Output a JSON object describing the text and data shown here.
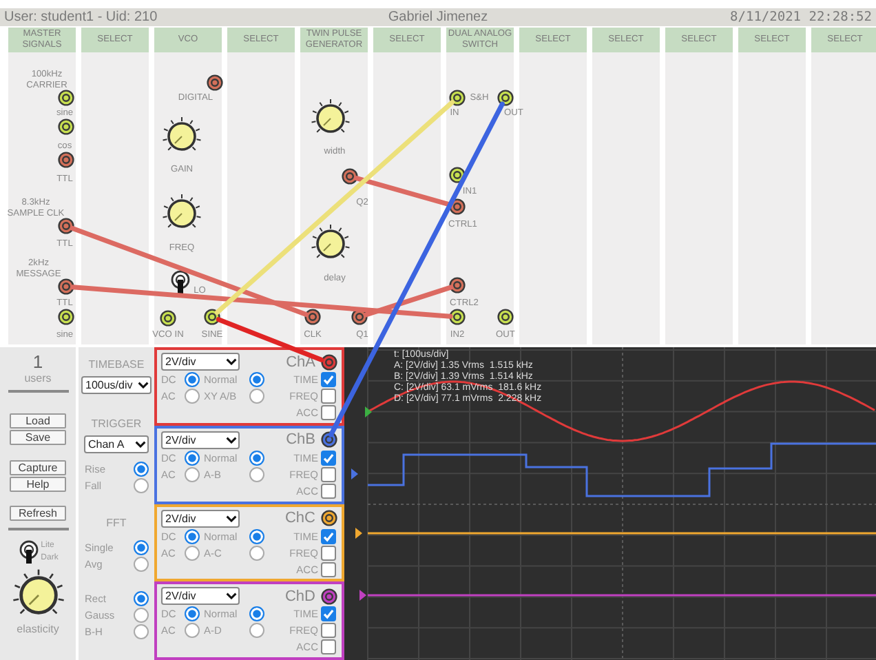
{
  "header": {
    "user": "User: student1 - Uid: 210",
    "name": "Gabriel Jimenez",
    "datetime": "8/11/2021 22:28:52"
  },
  "modules": [
    {
      "title": "MASTER SIGNALS",
      "kind": "master",
      "items": [
        {
          "kind": "text",
          "label": "100kHz\nCARRIER"
        },
        {
          "kind": "jack",
          "color": "#c8e050"
        },
        {
          "kind": "text",
          "label": "sine"
        },
        {
          "kind": "jack",
          "color": "#c8e050"
        },
        {
          "kind": "text",
          "label": "cos"
        },
        {
          "kind": "jack",
          "color": "#d4705a"
        },
        {
          "kind": "text",
          "label": "TTL"
        },
        {
          "kind": "text",
          "label": "8.3kHz\nSAMPLE CLK"
        },
        {
          "kind": "jack",
          "color": "#d4705a"
        },
        {
          "kind": "text",
          "label": "TTL"
        },
        {
          "kind": "text",
          "label": "2kHz\nMESSAGE"
        },
        {
          "kind": "jack",
          "color": "#d4705a"
        },
        {
          "kind": "text",
          "label": "TTL"
        },
        {
          "kind": "jack",
          "color": "#c8e050"
        },
        {
          "kind": "text",
          "label": "sine"
        }
      ]
    },
    {
      "title": "SELECT"
    },
    {
      "title": "VCO",
      "kind": "vco",
      "items": [
        {
          "kind": "jack",
          "color": "#d4705a"
        },
        {
          "kind": "text",
          "label": "DIGITAL"
        },
        {
          "kind": "knob"
        },
        {
          "kind": "text",
          "label": "GAIN"
        },
        {
          "kind": "knob"
        },
        {
          "kind": "text",
          "label": "FREQ"
        },
        {
          "kind": "toggle",
          "on": false
        },
        {
          "kind": "text",
          "label": "LO"
        },
        {
          "kind": "jack",
          "color": "#c8e050"
        },
        {
          "kind": "text",
          "label": "VCO IN"
        },
        {
          "kind": "jack",
          "color": "#c8e050"
        },
        {
          "kind": "text",
          "label": "SINE"
        }
      ]
    },
    {
      "title": "SELECT"
    },
    {
      "title": "TWIN PULSE GENERATOR",
      "kind": "twin",
      "items": [
        {
          "kind": "knob"
        },
        {
          "kind": "text",
          "label": "width"
        },
        {
          "kind": "jack",
          "color": "#d4705a"
        },
        {
          "kind": "text",
          "label": "Q2"
        },
        {
          "kind": "knob"
        },
        {
          "kind": "text",
          "label": "delay"
        },
        {
          "kind": "jack",
          "color": "#d4705a"
        },
        {
          "kind": "text",
          "label": "CLK"
        },
        {
          "kind": "jack",
          "color": "#d4705a"
        },
        {
          "kind": "text",
          "label": "Q1"
        }
      ]
    },
    {
      "title": "SELECT"
    },
    {
      "title": "DUAL ANALOG SWITCH",
      "kind": "switch",
      "items": [
        {
          "kind": "jack",
          "color": "#c8e050"
        },
        {
          "kind": "text",
          "label": "S&H"
        },
        {
          "kind": "jack",
          "color": "#c8e050"
        },
        {
          "kind": "text",
          "label": "IN"
        },
        {
          "kind": "text",
          "label": "OUT"
        },
        {
          "kind": "jack",
          "color": "#c8e050"
        },
        {
          "kind": "text",
          "label": "IN1"
        },
        {
          "kind": "jack",
          "color": "#d4705a"
        },
        {
          "kind": "text",
          "label": "CTRL1"
        },
        {
          "kind": "jack",
          "color": "#d4705a"
        },
        {
          "kind": "text",
          "label": "CTRL2"
        },
        {
          "kind": "jack",
          "color": "#c8e050"
        },
        {
          "kind": "text",
          "label": "IN2"
        },
        {
          "kind": "jack",
          "color": "#c8e050"
        },
        {
          "kind": "text",
          "label": "OUT"
        }
      ]
    },
    {
      "title": "SELECT"
    },
    {
      "title": "SELECT"
    },
    {
      "title": "SELECT"
    },
    {
      "title": "SELECT"
    },
    {
      "title": "SELECT"
    }
  ],
  "sidebar": {
    "users_count": "1",
    "users_label": "users",
    "buttons": [
      "Load",
      "Save",
      "Capture",
      "Help",
      "Refresh"
    ],
    "theme_labels": [
      "Lite",
      "Dark"
    ],
    "theme_toggle_on": false,
    "knob_label": "elasticity"
  },
  "controls": {
    "timebase": {
      "label": "TIMEBASE",
      "value": "100us/div"
    },
    "trigger": {
      "label": "TRIGGER",
      "value": "Chan A",
      "options": [
        {
          "label": "Rise",
          "selected": true
        },
        {
          "label": "Fall",
          "selected": false
        }
      ]
    },
    "fft": {
      "label": "FFT",
      "modes": [
        {
          "label": "Single",
          "selected": true
        },
        {
          "label": "Avg",
          "selected": false
        }
      ],
      "windows": [
        {
          "label": "Rect",
          "selected": true
        },
        {
          "label": "Gauss",
          "selected": false
        },
        {
          "label": "B-H",
          "selected": false
        }
      ]
    }
  },
  "channels": [
    {
      "name": "ChA",
      "color": "#e03a3a",
      "scale": "2V/div",
      "coupling": [
        {
          "label": "DC",
          "selected": true
        },
        {
          "label": "AC",
          "selected": false
        }
      ],
      "mode": [
        {
          "label": "Normal",
          "selected": true
        },
        {
          "label": "XY A/B",
          "selected": false
        }
      ],
      "displays": [
        {
          "label": "TIME",
          "checked": true
        },
        {
          "label": "FREQ",
          "checked": false
        },
        {
          "label": "ACC",
          "checked": false
        }
      ]
    },
    {
      "name": "ChB",
      "color": "#4a72e0",
      "scale": "2V/div",
      "coupling": [
        {
          "label": "DC",
          "selected": true
        },
        {
          "label": "AC",
          "selected": false
        }
      ],
      "mode": [
        {
          "label": "Normal",
          "selected": true
        },
        {
          "label": "A-B",
          "selected": false
        }
      ],
      "displays": [
        {
          "label": "TIME",
          "checked": true
        },
        {
          "label": "FREQ",
          "checked": false
        },
        {
          "label": "ACC",
          "checked": false
        }
      ]
    },
    {
      "name": "ChC",
      "color": "#f0a830",
      "scale": "2V/div",
      "coupling": [
        {
          "label": "DC",
          "selected": true
        },
        {
          "label": "AC",
          "selected": false
        }
      ],
      "mode": [
        {
          "label": "Normal",
          "selected": true
        },
        {
          "label": "A-C",
          "selected": false
        }
      ],
      "displays": [
        {
          "label": "TIME",
          "checked": true
        },
        {
          "label": "FREQ",
          "checked": false
        },
        {
          "label": "ACC",
          "checked": false
        }
      ]
    },
    {
      "name": "ChD",
      "color": "#c040c0",
      "scale": "2V/div",
      "coupling": [
        {
          "label": "DC",
          "selected": true
        },
        {
          "label": "AC",
          "selected": false
        }
      ],
      "mode": [
        {
          "label": "Normal",
          "selected": true
        },
        {
          "label": "A-D",
          "selected": false
        }
      ],
      "displays": [
        {
          "label": "TIME",
          "checked": true
        },
        {
          "label": "FREQ",
          "checked": false
        },
        {
          "label": "ACC",
          "checked": false
        }
      ]
    }
  ],
  "scope": {
    "readouts": [
      "t: [100us/div]",
      "A: [2V/div] 1.35 Vrms  1.515 kHz",
      "B: [2V/div] 1.39 Vrms  1.514 kHz",
      "C: [2V/div] 63.1 mVrms  181.6 kHz",
      "D: [2V/div] 77.1 mVrms  2.228 kHz"
    ]
  }
}
